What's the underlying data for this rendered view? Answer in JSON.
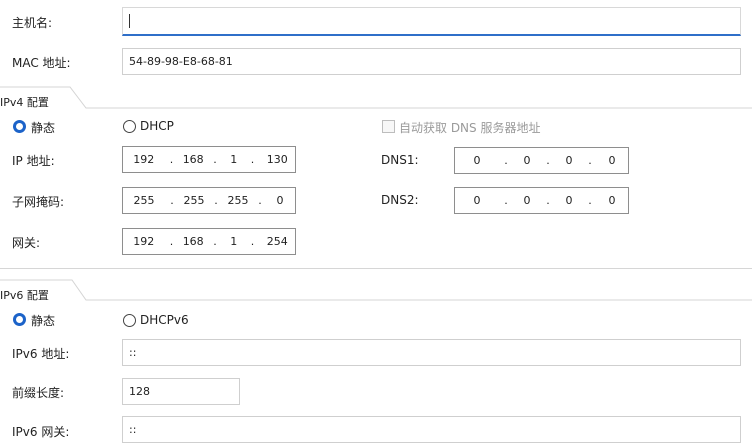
{
  "hostname": {
    "label": "主机名:",
    "value": ""
  },
  "mac": {
    "label": "MAC 地址:",
    "value": "54-89-98-E8-68-81"
  },
  "ipv4": {
    "section_title": "IPv4 配置",
    "static_label": "静态",
    "dhcp_label": "DHCP",
    "auto_dns_label": "自动获取 DNS 服务器地址",
    "ip_label": "IP 地址:",
    "ip": [
      "192",
      "168",
      "1",
      "130"
    ],
    "mask_label": "子网掩码:",
    "mask": [
      "255",
      "255",
      "255",
      "0"
    ],
    "gateway_label": "网关:",
    "gateway": [
      "192",
      "168",
      "1",
      "254"
    ],
    "dns1_label": "DNS1:",
    "dns1": [
      "0",
      "0",
      "0",
      "0"
    ],
    "dns2_label": "DNS2:",
    "dns2": [
      "0",
      "0",
      "0",
      "0"
    ],
    "selected_mode": "static"
  },
  "ipv6": {
    "section_title": "IPv6 配置",
    "static_label": "静态",
    "dhcp_label": "DHCPv6",
    "ip_label": "IPv6 地址:",
    "ip_value": "::",
    "prefix_label": "前缀长度:",
    "prefix_value": "128",
    "gateway_label": "IPv6 网关:",
    "gateway_value": "::",
    "selected_mode": "static"
  },
  "colors": {
    "accent": "#1c63c9",
    "focus_underline": "#2f6fc9"
  }
}
